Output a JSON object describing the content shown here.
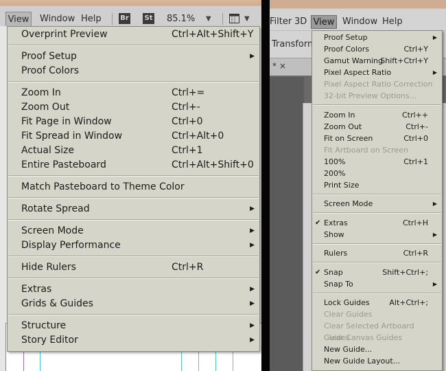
{
  "left": {
    "menubar": {
      "view": "View",
      "window": "Window",
      "help": "Help",
      "bridge_badge": "Br",
      "stock_badge": "St",
      "zoom": "85.1%"
    },
    "menu": [
      {
        "type": "item",
        "label": "Overprint Preview",
        "shortcut": "Ctrl+Alt+Shift+Y"
      },
      {
        "type": "sep"
      },
      {
        "type": "item",
        "label": "Proof Setup",
        "submenu": true
      },
      {
        "type": "item",
        "label": "Proof Colors"
      },
      {
        "type": "sep"
      },
      {
        "type": "item",
        "label": "Zoom In",
        "shortcut": "Ctrl+="
      },
      {
        "type": "item",
        "label": "Zoom Out",
        "shortcut": "Ctrl+-"
      },
      {
        "type": "item",
        "label": "Fit Page in Window",
        "shortcut": "Ctrl+0"
      },
      {
        "type": "item",
        "label": "Fit Spread in Window",
        "shortcut": "Ctrl+Alt+0"
      },
      {
        "type": "item",
        "label": "Actual Size",
        "shortcut": "Ctrl+1"
      },
      {
        "type": "item",
        "label": "Entire Pasteboard",
        "shortcut": "Ctrl+Alt+Shift+0"
      },
      {
        "type": "sep"
      },
      {
        "type": "item",
        "label": "Match Pasteboard to Theme Color"
      },
      {
        "type": "sep"
      },
      {
        "type": "item",
        "label": "Rotate Spread",
        "submenu": true
      },
      {
        "type": "sep"
      },
      {
        "type": "item",
        "label": "Screen Mode",
        "submenu": true
      },
      {
        "type": "item",
        "label": "Display Performance",
        "submenu": true
      },
      {
        "type": "sep"
      },
      {
        "type": "item",
        "label": "Hide Rulers",
        "shortcut": "Ctrl+R"
      },
      {
        "type": "sep"
      },
      {
        "type": "item",
        "label": "Extras",
        "submenu": true
      },
      {
        "type": "item",
        "label": "Grids & Guides",
        "submenu": true
      },
      {
        "type": "sep"
      },
      {
        "type": "item",
        "label": "Structure",
        "submenu": true
      },
      {
        "type": "item",
        "label": "Story Editor",
        "submenu": true
      }
    ]
  },
  "right": {
    "menubar": {
      "filter": "Filter",
      "3d": "3D",
      "view": "View",
      "window": "Window",
      "help": "Help",
      "transform": "Transform",
      "tab_close": "* ×"
    },
    "menu": [
      {
        "type": "item",
        "label": "Proof Setup",
        "submenu": true
      },
      {
        "type": "item",
        "label": "Proof Colors",
        "shortcut": "Ctrl+Y"
      },
      {
        "type": "item",
        "label": "Gamut Warning",
        "shortcut": "Shift+Ctrl+Y"
      },
      {
        "type": "item",
        "label": "Pixel Aspect Ratio",
        "submenu": true
      },
      {
        "type": "item",
        "label": "Pixel Aspect Ratio Correction",
        "disabled": true
      },
      {
        "type": "item",
        "label": "32-bit Preview Options...",
        "disabled": true
      },
      {
        "type": "sep"
      },
      {
        "type": "item",
        "label": "Zoom In",
        "shortcut": "Ctrl++"
      },
      {
        "type": "item",
        "label": "Zoom Out",
        "shortcut": "Ctrl+-"
      },
      {
        "type": "item",
        "label": "Fit on Screen",
        "shortcut": "Ctrl+0"
      },
      {
        "type": "item",
        "label": "Fit Artboard on Screen",
        "disabled": true
      },
      {
        "type": "item",
        "label": "100%",
        "shortcut": "Ctrl+1"
      },
      {
        "type": "item",
        "label": "200%"
      },
      {
        "type": "item",
        "label": "Print Size"
      },
      {
        "type": "sep"
      },
      {
        "type": "item",
        "label": "Screen Mode",
        "submenu": true
      },
      {
        "type": "sep"
      },
      {
        "type": "item",
        "label": "Extras",
        "shortcut": "Ctrl+H",
        "checked": true
      },
      {
        "type": "item",
        "label": "Show",
        "submenu": true
      },
      {
        "type": "sep"
      },
      {
        "type": "item",
        "label": "Rulers",
        "shortcut": "Ctrl+R"
      },
      {
        "type": "sep"
      },
      {
        "type": "item",
        "label": "Snap",
        "shortcut": "Shift+Ctrl+;",
        "checked": true
      },
      {
        "type": "item",
        "label": "Snap To",
        "submenu": true
      },
      {
        "type": "sep"
      },
      {
        "type": "item",
        "label": "Lock Guides",
        "shortcut": "Alt+Ctrl+;"
      },
      {
        "type": "item",
        "label": "Clear Guides",
        "disabled": true
      },
      {
        "type": "item",
        "label": "Clear Selected Artboard Guides",
        "disabled": true
      },
      {
        "type": "item",
        "label": "Clear Canvas Guides",
        "disabled": true
      },
      {
        "type": "item",
        "label": "New Guide..."
      },
      {
        "type": "item",
        "label": "New Guide Layout..."
      }
    ]
  }
}
